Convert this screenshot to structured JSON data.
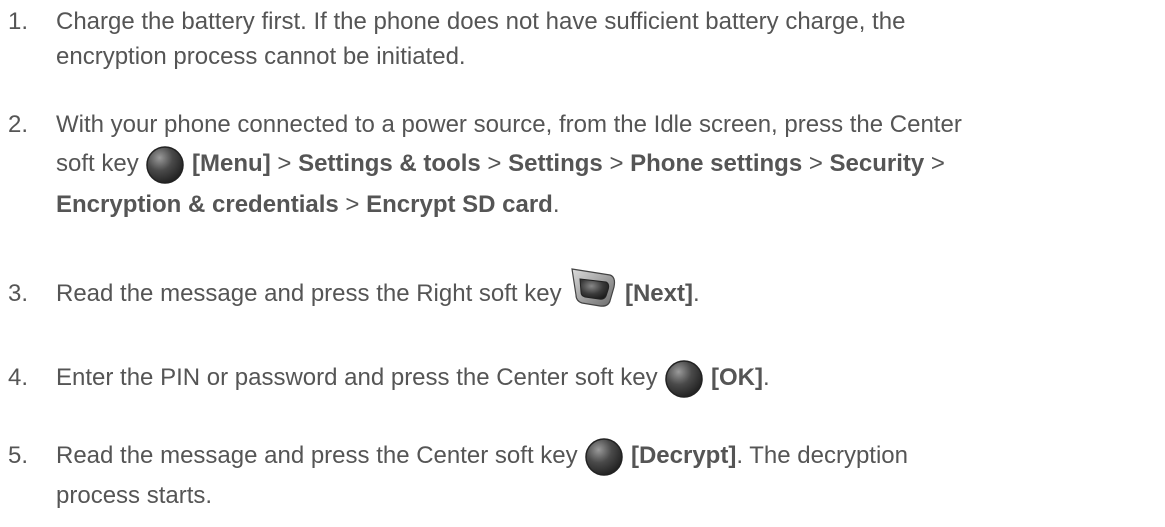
{
  "steps": [
    {
      "num": "1.",
      "lines": [
        [
          "Charge the battery first. If the phone does not have sufficient battery charge, the"
        ],
        [
          "encryption process cannot be initiated."
        ]
      ]
    },
    {
      "num": "2.",
      "l1": "With your phone connected to a power source, from the Idle screen, press the Center",
      "l2a": "soft key",
      "l2b": "[Menu]",
      "l2c": " > ",
      "l2d": "Settings & tools",
      "l2e": " > ",
      "l2f": "Settings",
      "l2g": " > ",
      "l2h": "Phone settings",
      "l2i": " > ",
      "l2j": "Security",
      "l2k": " >",
      "l3a": "Encryption & credentials",
      "l3b": " > ",
      "l3c": "Encrypt SD card",
      "l3d": "."
    },
    {
      "num": "3.",
      "a": "Read the message and press the Right soft key",
      "b": "[Next]",
      "c": "."
    },
    {
      "num": "4.",
      "a": "Enter the PIN or password and press the Center soft key",
      "b": "[OK]",
      "c": "."
    },
    {
      "num": "5.",
      "a": "Read the message and press the Center soft key",
      "b": "[Decrypt]",
      "c": ". The decryption",
      "d": "process starts."
    }
  ],
  "icons": {
    "center_key": "center-soft-key-icon",
    "right_key": "right-soft-key-icon"
  }
}
